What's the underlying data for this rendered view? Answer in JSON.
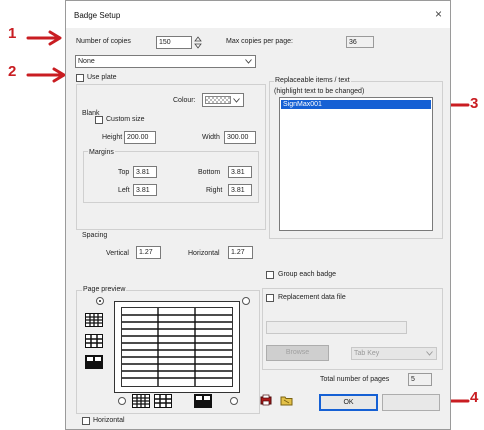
{
  "window": {
    "title": "Badge Setup",
    "close_glyph": "×"
  },
  "copies": {
    "label": "Number of copies",
    "value": "150",
    "max_label": "Max copies per page:",
    "max_value": "36"
  },
  "template_select": {
    "value": "None"
  },
  "use_plate": {
    "label": "Use plate"
  },
  "colour": {
    "label": "Colour:"
  },
  "blank": {
    "label": "Blank",
    "custom_size": "Custom size",
    "height_label": "Height",
    "height_value": "200.00",
    "width_label": "Width",
    "width_value": "300.00"
  },
  "margins": {
    "label": "Margins",
    "top_label": "Top",
    "top_value": "3.81",
    "bottom_label": "Bottom",
    "bottom_value": "3.81",
    "left_label": "Left",
    "left_value": "3.81",
    "right_label": "Right",
    "right_value": "3.81"
  },
  "spacing": {
    "label": "Spacing",
    "vertical_label": "Vertical",
    "vertical_value": "1.27",
    "horizontal_label": "Horizontal",
    "horizontal_value": "1.27"
  },
  "replaceable": {
    "label": "Replaceable items / text",
    "hint": "(highlight text to be changed)",
    "items": [
      "SignMax001"
    ]
  },
  "group_each": {
    "label": "Group each badge"
  },
  "page_preview": {
    "label": "Page preview"
  },
  "replacement_file": {
    "label": "Replacement data file",
    "browse_label": "Browse",
    "delimiter_value": "Tab Key"
  },
  "total_pages": {
    "label": "Total number of pages",
    "value": "5"
  },
  "buttons": {
    "ok_label": "OK",
    "cancel_label": ""
  },
  "horizontal": {
    "label": "Horizontal"
  },
  "annotations": [
    "1",
    "2",
    "3",
    "4"
  ],
  "colors": {
    "annotation": "#c91d22",
    "selection": "#1560d4"
  }
}
